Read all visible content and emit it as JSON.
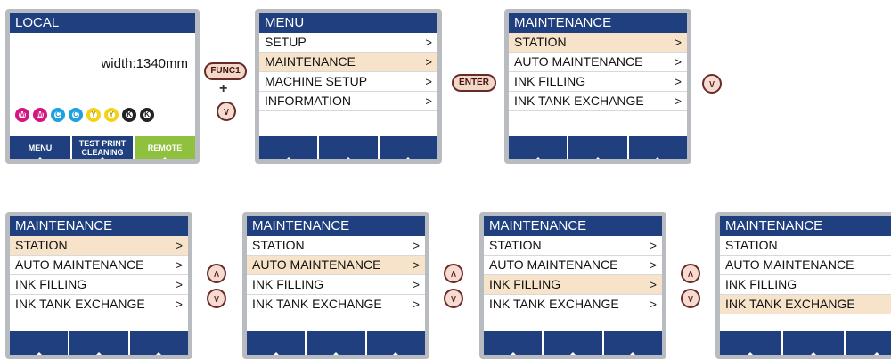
{
  "local_screen": {
    "title": "LOCAL",
    "width_text": "width:1340mm",
    "inks": [
      "M",
      "M",
      "C",
      "C",
      "Y",
      "Y",
      "K",
      "K"
    ],
    "fkeys": [
      "MENU",
      "TEST PRINT\nCLEANING",
      "REMOTE"
    ]
  },
  "keys": {
    "func1": "FUNC1",
    "plus": "+",
    "enter": "ENTER",
    "down": "∨",
    "up": "∧"
  },
  "menu_screen": {
    "title": "MENU",
    "items": [
      {
        "label": "SETUP",
        "arrow": ">"
      },
      {
        "label": "MAINTENANCE",
        "arrow": ">"
      },
      {
        "label": "MACHINE SETUP",
        "arrow": ">"
      },
      {
        "label": "INFORMATION",
        "arrow": ">"
      }
    ]
  },
  "maintenance_screen": {
    "title": "MAINTENANCE",
    "items": [
      {
        "label": "STATION",
        "arrow": ">"
      },
      {
        "label": "AUTO MAINTENANCE",
        "arrow": ">"
      },
      {
        "label": "INK FILLING",
        "arrow": ">"
      },
      {
        "label": "INK TANK EXCHANGE",
        "arrow": ">"
      }
    ]
  },
  "colors": {
    "title_bar": "#1f3f7f",
    "selected_row": "#f6e3c9",
    "remote_key": "#8fc13e"
  }
}
